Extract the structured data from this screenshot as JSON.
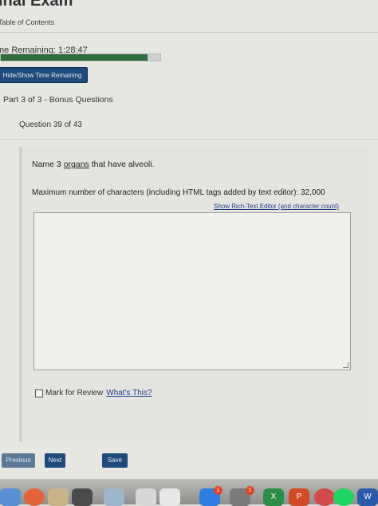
{
  "header": {
    "exam_title": "inal Exam",
    "toc_label": "Table of Contents"
  },
  "timer": {
    "label": "me Remaining: 1:28:47",
    "progress_fraction": 0.92,
    "hide_button": "Hide/Show Time Remaining"
  },
  "section": {
    "title": "Part 3 of 3 - Bonus Questions",
    "question_number": "Question 39 of 43"
  },
  "question": {
    "prompt_before": "Name 3 ",
    "prompt_underlined": "organs",
    "prompt_after": " that have alveoli.",
    "max_chars": "Maximum number of characters (including HTML tags added by text editor): 32,000",
    "rte_link": "Show Rich-Text Editor (and character count)",
    "answer_value": ""
  },
  "review": {
    "label": "Mark for Review",
    "whats_this": "What's This?"
  },
  "nav": {
    "previous": "Previous",
    "next": "Next",
    "save": "Save"
  },
  "dock": {
    "badge_1": "1",
    "badge_2": "1",
    "x_label": "X",
    "p_label": "P",
    "w_label": "W"
  },
  "colors": {
    "button_blue": "#1f4a7a",
    "progress_green": "#2f6b3d",
    "link_blue": "#1f3f8f"
  }
}
